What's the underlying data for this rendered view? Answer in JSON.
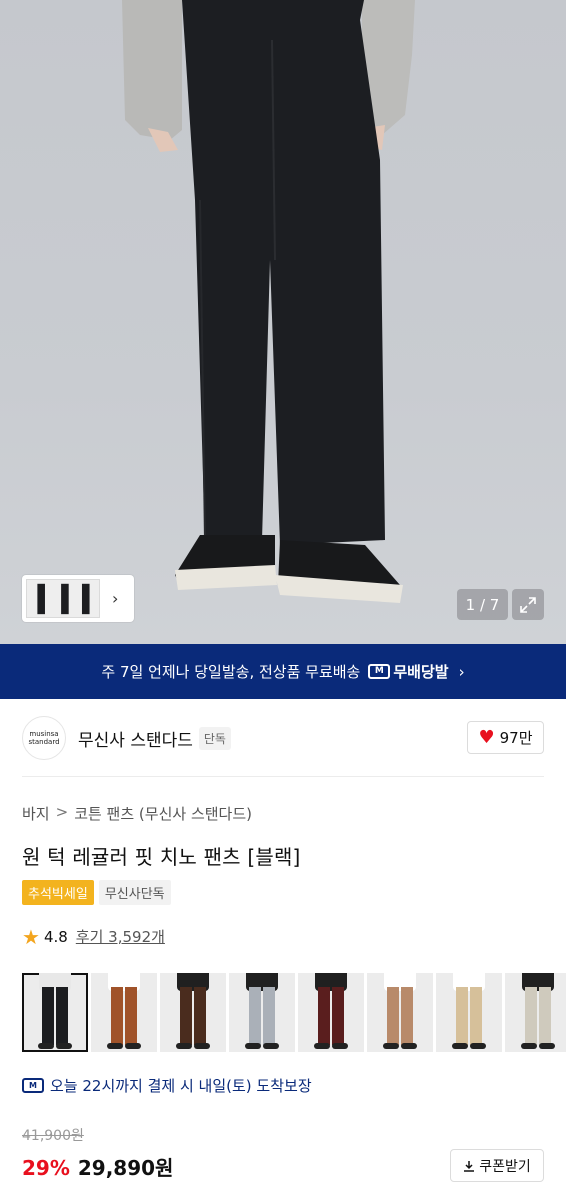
{
  "gallery": {
    "counter": "1 / 7",
    "thumb_icon": "chevron-right-icon",
    "expand_icon": "expand-icon"
  },
  "banner": {
    "text": "주 7일 언제나 당일발송, 전상품 무료배송",
    "logo_label": "무배당발",
    "chevron": "›"
  },
  "brand": {
    "logo_line1": "musinsa",
    "logo_line2": "standard",
    "name": "무신사 스탠다드",
    "tag": "단독",
    "likes": "97만"
  },
  "breadcrumb": {
    "items": [
      "바지",
      "코튼 팬츠 (무신사 스탠다드)"
    ],
    "separator": ">"
  },
  "product": {
    "title": "원 턱 레귤러 핏 치노 팬츠 [블랙]",
    "badge_sale": "추석빅세일",
    "badge_exclusive": "무신사단독",
    "rating": "4.8",
    "reviews": "후기 3,592개"
  },
  "color_options": [
    {
      "pants": "#1c1d20",
      "top": "#e8e8e8",
      "selected": true
    },
    {
      "pants": "#a0532a",
      "top": "#ffffff",
      "selected": false
    },
    {
      "pants": "#4a2c1e",
      "top": "#202020",
      "selected": false
    },
    {
      "pants": "#aab0b8",
      "top": "#202020",
      "selected": false
    },
    {
      "pants": "#5a1e1e",
      "top": "#202020",
      "selected": false
    },
    {
      "pants": "#b88a6a",
      "top": "#ffffff",
      "selected": false
    },
    {
      "pants": "#d6c09a",
      "top": "#ffffff",
      "selected": false
    },
    {
      "pants": "#cfcabd",
      "top": "#202020",
      "selected": false
    }
  ],
  "delivery": {
    "icon_label": "M",
    "text": "오늘 22시까지 결제 시 내일(토) 도착보장"
  },
  "pricing": {
    "original": "41,900원",
    "discount": "29%",
    "price": "29,890원",
    "coupon_label": "쿠폰받기"
  },
  "colors": {
    "brand_navy": "#0a2a7a",
    "sale_red": "#e8101e",
    "badge_yellow": "#f3b31e"
  }
}
